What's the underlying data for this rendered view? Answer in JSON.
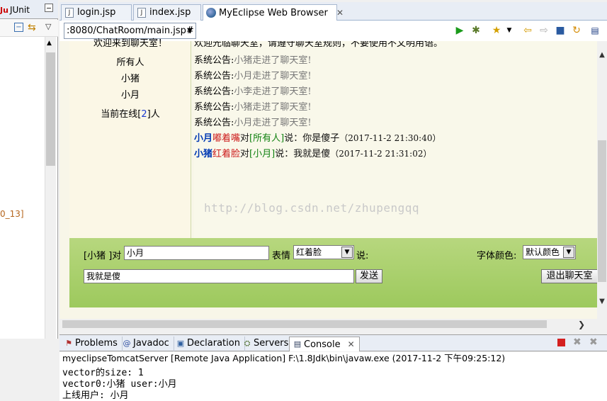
{
  "left_panel": {
    "tab_label": "JUnit",
    "fragment_text": "0_13]"
  },
  "editor_tabs": [
    {
      "label": "login.jsp"
    },
    {
      "label": "index.jsp"
    },
    {
      "label": "MyEclipse Web Browser"
    }
  ],
  "browser": {
    "url": ":8080/ChatRoom/main.jsp#",
    "top_cut_text": "欢迎光临聊天室，请遵守聊天室规则，不要使用不文明用语。",
    "left_cut_text": "欢迎来到聊天室！",
    "user_list": [
      "所有人",
      "小猪",
      "小月"
    ],
    "online": {
      "prefix": "当前在线[",
      "count": "2",
      "suffix": "]人"
    },
    "system_messages": [
      {
        "label": "系统公告:",
        "text": "小猪走进了聊天室!"
      },
      {
        "label": "系统公告:",
        "text": "小月走进了聊天室!"
      },
      {
        "label": "系统公告:",
        "text": "小李走进了聊天室!"
      },
      {
        "label": "系统公告:",
        "text": "小猪走进了聊天室!"
      },
      {
        "label": "系统公告:",
        "text": "小月走进了聊天室!"
      }
    ],
    "chat_messages": [
      {
        "sender": "小月",
        "expression": "嘟着嘴",
        "to_word": "对",
        "target": "[所有人]",
        "said": "说：你是傻子",
        "time": "（2017-11-2 21:30:40）"
      },
      {
        "sender": "小猪",
        "expression": "红着脸",
        "to_word": "对",
        "target": "[小月]",
        "said": "说：我就是傻",
        "time": "（2017-11-2 21:31:02）"
      }
    ],
    "watermark": "http://blog.csdn.net/zhupengqq",
    "form": {
      "me_label": "[小猪 ]对",
      "target_value": "小月",
      "expression_label": "表情",
      "expression_value": "红着脸",
      "say_label": "说:",
      "font_color_label": "字体颜色:",
      "font_color_value": "默认颜色",
      "message_value": "我就是傻",
      "send_label": "发送",
      "exit_label": "退出聊天室"
    }
  },
  "console": {
    "tabs": [
      {
        "label": "Problems"
      },
      {
        "label": "Javadoc"
      },
      {
        "label": "Declaration"
      },
      {
        "label": "Servers"
      },
      {
        "label": "Console"
      }
    ],
    "header": "myeclipseTomcatServer [Remote Java Application] F:\\1.8Jdk\\bin\\javaw.exe (2017-11-2 下午09:25:12)",
    "lines": [
      "vector的size: 1",
      "vector0:小猪 user:小月",
      "上线用户: 小月"
    ]
  },
  "colors": {
    "chat_bg": "#f9f8ea",
    "panel_green": "#9dc95d",
    "sender_blue": "#0039b3",
    "expression_red": "#cc1a1a",
    "target_green": "#128212"
  }
}
